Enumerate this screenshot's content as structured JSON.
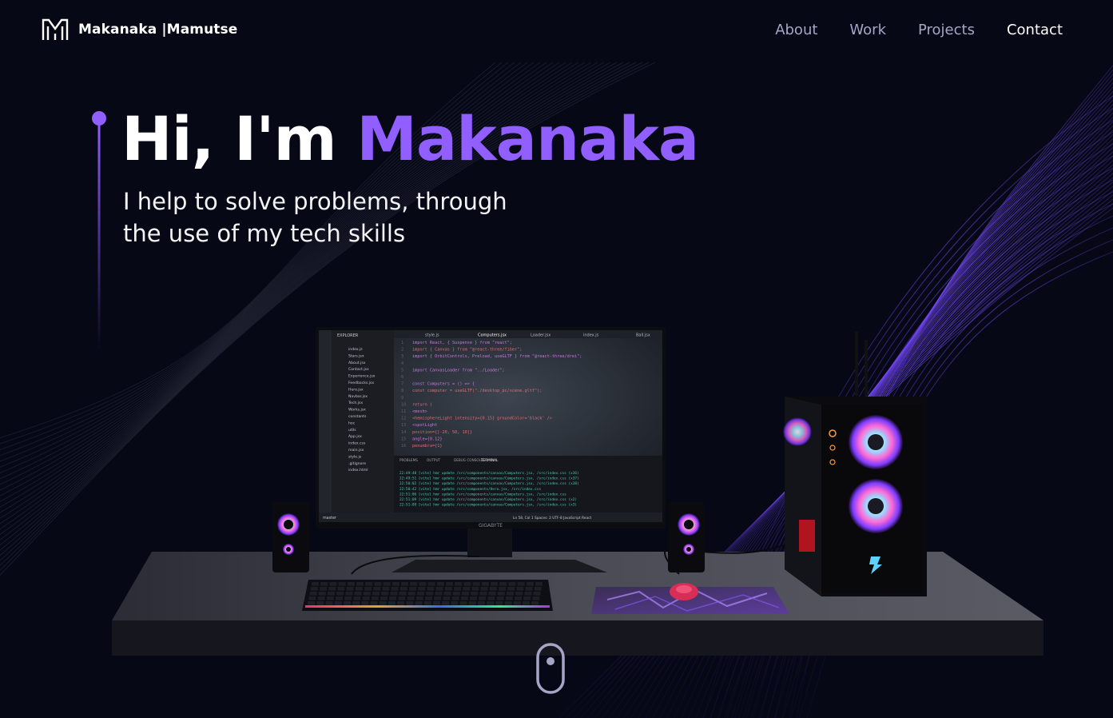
{
  "nav": {
    "logo_first": "Makanaka",
    "logo_last": "Mamutse",
    "links": [
      "About",
      "Work",
      "Projects",
      "Contact"
    ]
  },
  "hero": {
    "greeting": "Hi, I'm",
    "name": "Makanaka",
    "subtitle_line1": "I help to solve problems, through",
    "subtitle_line2": "the use of my tech skills"
  },
  "monitor": {
    "brand": "GIGABYTE",
    "tabs": [
      "style.js",
      "Computers.jsx",
      "Loader.jsx",
      "index.js",
      "Ball.jsx"
    ],
    "explorer_label": "EXPLORER",
    "files": [
      "index.js",
      "Stars.jsx",
      "About.jsx",
      "Contact.jsx",
      "Experience.jsx",
      "Feedbacks.jsx",
      "Hero.jsx",
      "Navbar.jsx",
      "Tech.jsx",
      "Works.jsx",
      "constants",
      "hoc",
      "utils",
      "App.jsx",
      "index.css",
      "main.jsx",
      "style.js",
      ".gitignore",
      "index.html"
    ],
    "code": [
      "import React, { Suspense } from \"react\";",
      "import { Canvas } from \"@react-three/fiber\";",
      "import { OrbitControls, Preload, useGLTF } from \"@react-three/drei\";",
      "",
      "import CanvasLoader from \"../Loader\";",
      "",
      "const Computers = () => {",
      "  const computer = useGLTF(\"./desktop_pc/scene.gltf\");",
      "",
      "  return (",
      "    <mesh>",
      "      <hemisphereLight intensity={0.15} groundColor='black' />",
      "      <spotLight",
      "        position={[-20, 50, 10]}",
      "        angle={0.12}",
      "        penumbra={1}"
    ],
    "terminal_tabs": [
      "PROBLEMS",
      "OUTPUT",
      "DEBUG CONSOLE",
      "TERMINAL"
    ],
    "terminal_lines": [
      "22:49:48 [vite] hmr update /src/components/canvas/Computers.jsx, /src/index.css (x36)",
      "22:49:51 [vite] hmr update /src/components/canvas/Computers.jsx, /src/index.css (x37)",
      "22:50:02 [vite] hmr update /src/components/canvas/Computers.jsx, /src/index.css (x38)",
      "22:50:42 [vite] hmr update /src/components/Hero.jsx, /src/index.css",
      "22:51:06 [vite] hmr update /src/components/canvas/Computers.jsx, /src/index.css",
      "22:51:09 [vite] hmr update /src/components/canvas/Computers.jsx, /src/index.css (x2)",
      "22:51:09 [vite] hmr update /src/components/canvas/Computers.jsx, /src/index.css (x3)"
    ],
    "status_left": "master",
    "status_mid": "Ln 58, Col 1   Spaces: 2   UTF-8   JavaScript React"
  },
  "colors": {
    "background": "#060816",
    "accent": "#915eff",
    "nav_link": "#a7a5c6",
    "nav_active": "#ffffff",
    "wave": "#7a4dff"
  },
  "icons": {
    "logo": "m-logo-icon",
    "scroll": "mouse-scroll-icon"
  }
}
